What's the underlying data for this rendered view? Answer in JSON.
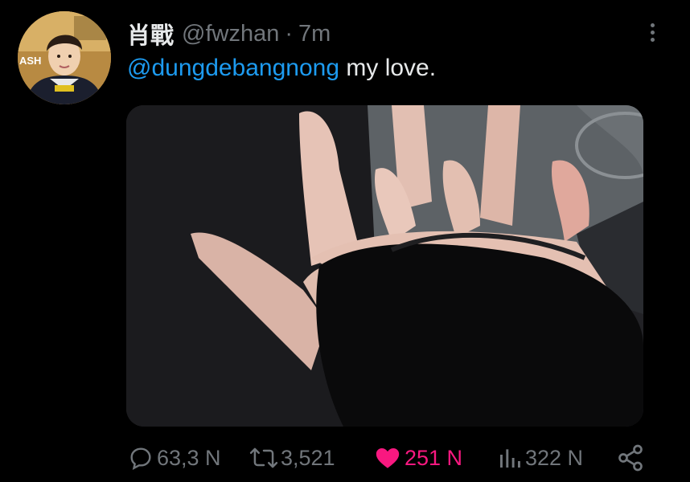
{
  "tweet": {
    "display_name": "肖戰",
    "handle": "@fwzhan",
    "separator": "·",
    "timestamp": "7m",
    "mention": "@dungdebangnong",
    "text": " my love.",
    "avatar_badge_text": "ASH"
  },
  "actions": {
    "reply_count": "63,3 N",
    "retweet_count": "3,521",
    "like_count": "251 N",
    "view_count": "322 N"
  },
  "icons": {
    "reply": "reply-icon",
    "retweet": "retweet-icon",
    "like": "heart-icon",
    "views": "views-icon",
    "share": "share-icon",
    "more": "more-vertical-icon"
  },
  "colors": {
    "background": "#000000",
    "mention": "#1d9bf0",
    "like": "#f91880",
    "muted": "#71767b"
  }
}
